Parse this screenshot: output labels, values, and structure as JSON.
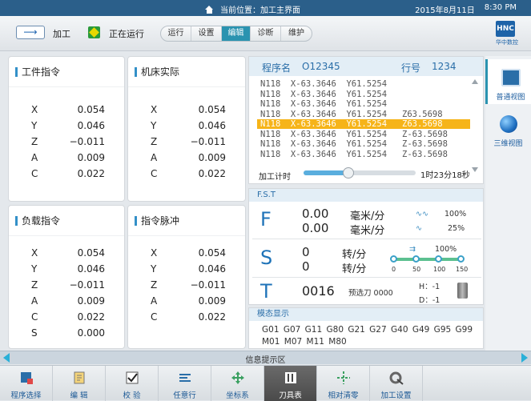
{
  "status_bar": {
    "location": "当前位置：加工主界面",
    "date": "2015年8月11日",
    "time": "8:30 PM"
  },
  "mode_bar": {
    "mode_label": "加工",
    "run_label": "正在运行",
    "tabs": [
      "运行",
      "设置",
      "编辑",
      "诊断",
      "维护"
    ],
    "active_tab": "编辑",
    "logo_text": "华中数控"
  },
  "work_cmd": {
    "title": "工件指令",
    "rows": [
      {
        "axis": "X",
        "value": "0.054"
      },
      {
        "axis": "Y",
        "value": "0.046"
      },
      {
        "axis": "Z",
        "value": "−0.011"
      },
      {
        "axis": "A",
        "value": "0.009"
      },
      {
        "axis": "C",
        "value": "0.022"
      }
    ]
  },
  "machine_actual": {
    "title": "机床实际",
    "rows": [
      {
        "axis": "X",
        "value": "0.054"
      },
      {
        "axis": "Y",
        "value": "0.046"
      },
      {
        "axis": "Z",
        "value": "−0.011"
      },
      {
        "axis": "A",
        "value": "0.009"
      },
      {
        "axis": "C",
        "value": "0.022"
      }
    ]
  },
  "load_cmd": {
    "title": "负载指令",
    "rows": [
      {
        "axis": "X",
        "value": "0.054"
      },
      {
        "axis": "Y",
        "value": "0.046"
      },
      {
        "axis": "Z",
        "value": "−0.011"
      },
      {
        "axis": "A",
        "value": "0.009"
      },
      {
        "axis": "C",
        "value": "0.022"
      },
      {
        "axis": "S",
        "value": "0.000"
      }
    ]
  },
  "pulse_cmd": {
    "title": "指令脉冲",
    "rows": [
      {
        "axis": "X",
        "value": "0.054"
      },
      {
        "axis": "Y",
        "value": "0.046"
      },
      {
        "axis": "Z",
        "value": "−0.011"
      },
      {
        "axis": "A",
        "value": "0.009"
      },
      {
        "axis": "C",
        "value": "0.022"
      }
    ]
  },
  "program": {
    "name_label": "程序名",
    "name": "O12345",
    "line_label": "行号",
    "line": "1234",
    "lines": [
      "N118  X-63.3646  Y61.5254",
      "N118  X-63.3646  Y61.5254",
      "N118  X-63.3646  Y61.5254",
      "N118  X-63.3646  Y61.5254   Z63.5698",
      "N118  X-63.3646  Y61.5254   Z63.5698",
      "N118  X-63.3646  Y61.5254   Z-63.5698",
      "N118  X-63.3646  Y61.5254   Z-63.5698",
      "N118  X-63.3646  Y61.5254   Z-63.5698"
    ],
    "current_index": 4,
    "timer_label": "加工计时",
    "timer_value": "1时23分18秒",
    "timer_progress": 0.4
  },
  "fst": {
    "title": "F.S.T",
    "f_letter": "F",
    "f_values": [
      "0.00",
      "0.00"
    ],
    "f_units": [
      "毫米/分",
      "毫米/分"
    ],
    "f_override_1": "100%",
    "f_override_2": "25%",
    "s_letter": "S",
    "s_values": [
      "0",
      "0"
    ],
    "s_units": [
      "转/分",
      "转/分"
    ],
    "s_override": "100%",
    "s_scale": [
      "0",
      "50",
      "100",
      "150"
    ],
    "t_letter": "T",
    "t_value": "0016",
    "t_preselect": "预选刀 0000",
    "h_label": "H：-1",
    "d_label": "D：-1"
  },
  "modal": {
    "title": "模态显示",
    "line1": "G01  G07  G11  G80  G21  G27  G40  G49  G95  G99",
    "line2": "M01  M07  M11  M80"
  },
  "sidebar": {
    "items": [
      {
        "label": "普通视图",
        "icon": "image-icon"
      },
      {
        "label": "三维视图",
        "icon": "globe-icon"
      }
    ]
  },
  "info_bar": {
    "label": "信息提示区"
  },
  "bottom_bar": {
    "buttons": [
      {
        "label": "程序选择",
        "icon": "program-select-icon"
      },
      {
        "label": "编 辑",
        "icon": "edit-icon"
      },
      {
        "label": "校  验",
        "icon": "check-icon"
      },
      {
        "label": "任意行",
        "icon": "any-line-icon"
      },
      {
        "label": "坐标系",
        "icon": "coordinate-icon"
      },
      {
        "label": "刀具表",
        "icon": "tool-table-icon"
      },
      {
        "label": "相对清零",
        "icon": "relative-zero-icon"
      },
      {
        "label": "加工设置",
        "icon": "machining-settings-icon"
      }
    ],
    "active_index": 5
  },
  "colors": {
    "accent": "#2a93b0",
    "highlight": "#f6b419",
    "title_blue": "#2a6ea8"
  }
}
